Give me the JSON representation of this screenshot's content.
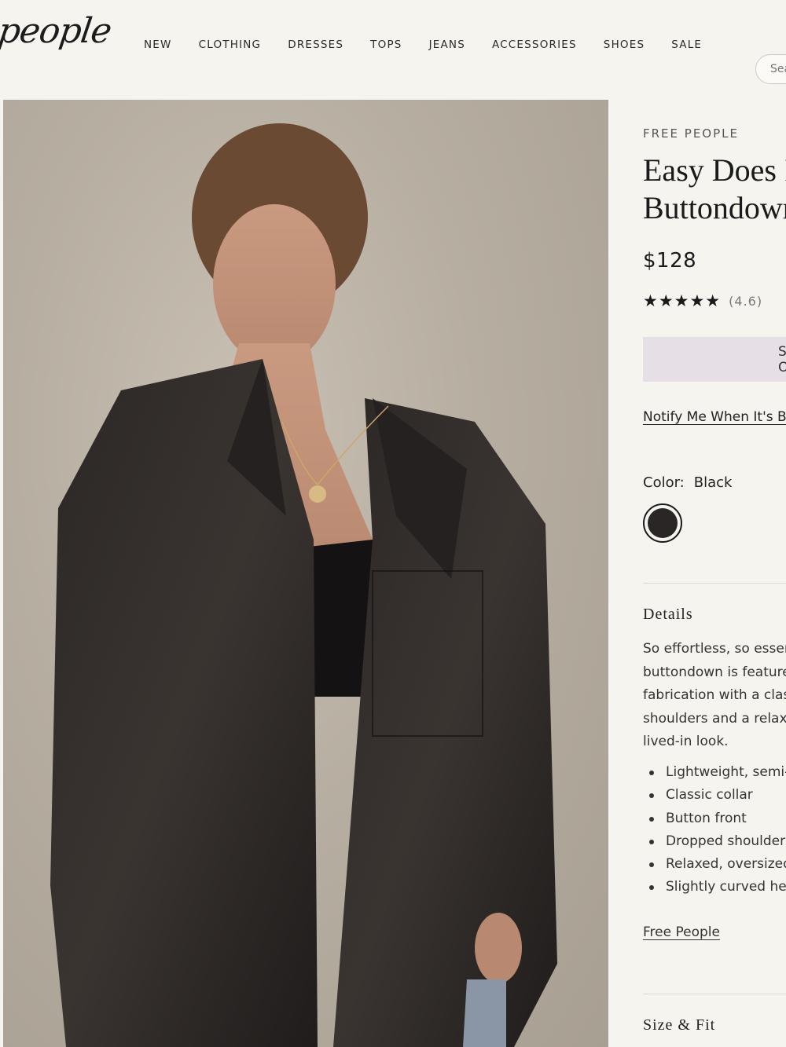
{
  "header": {
    "logo": "people",
    "nav": [
      "NEW",
      "CLOTHING",
      "DRESSES",
      "TOPS",
      "JEANS",
      "ACCESSORIES",
      "SHOES",
      "SALE"
    ],
    "search_placeholder": "Search"
  },
  "product": {
    "brand": "FREE PEOPLE",
    "title_line1": "Easy Does It",
    "title_line2": "Buttondown",
    "price": "$128",
    "rating_stars": "★★★★★",
    "rating_value": 4.6,
    "rating_label": "(4.6)",
    "add_button_label": "SOLD OUT",
    "notify_link": "Notify Me When It's Back",
    "color_label": "Color:",
    "color_value": "Black",
    "swatch_color": "#2a2626",
    "details_heading": "Details",
    "description_lines": [
      "So effortless, so essential, this",
      "buttondown is featured in a sheen",
      "fabrication with a classic collar, dropped",
      "shoulders and a relaxed fit for a",
      "lived-in look."
    ],
    "bullets": [
      "Lightweight, semi-sheer",
      "Classic collar",
      "Button front",
      "Dropped shoulders",
      "Relaxed, oversized fit",
      "Slightly curved hem"
    ],
    "brand_link": "Free People",
    "size_fit_heading": "Size & Fit"
  },
  "colors": {
    "background": "#f6f4ef",
    "button_bg": "#e7dfe6"
  }
}
